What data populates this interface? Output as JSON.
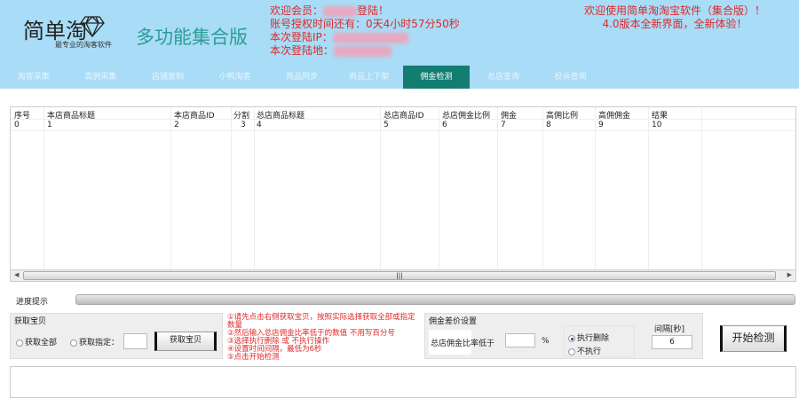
{
  "header": {
    "logo": "简单淘",
    "logo_sub": "最专业的淘客软件",
    "edition": "多功能集合版",
    "welcome_prefix": "欢迎会员：",
    "welcome_suffix": "登陆！",
    "license": "账号授权时间还有：0天4小时57分50秒",
    "ip_label": "本次登陆IP：",
    "location_label": "本次登陆地：",
    "notice_line1": "欢迎使用简单淘淘宝软件（集合版）！",
    "notice_line2": "4.0版本全新界面，全新体验！"
  },
  "nav": {
    "tabs": [
      "淘客采集",
      "高佣采集",
      "店铺复制",
      "小鸭淘客",
      "商品同步",
      "商品上下架",
      "佣金检测",
      "总店查询",
      "投诉查询"
    ],
    "active": "佣金检测",
    "active_color": "#137d72"
  },
  "grid": {
    "columns": [
      "序号",
      "本店商品标题",
      "本店商品ID",
      "分割",
      "总店商品标题",
      "总店商品ID",
      "总店佣金比例",
      "佣金",
      "高佣比例",
      "高佣佣金",
      "结果"
    ],
    "rows": [
      [
        "0",
        "1",
        "2",
        "3",
        "4",
        "5",
        "6",
        "7",
        "8",
        "9",
        "10"
      ]
    ]
  },
  "progress": {
    "label": "进度提示",
    "value": 0
  },
  "fetch": {
    "title": "获取宝贝",
    "opt_all": "获取全部",
    "opt_specified": "获取指定：",
    "count_value": "",
    "button": "获取宝贝"
  },
  "hints": [
    "①请先点击右侧获取宝贝，按照实际选择获取全部或指定数量",
    "②然后输入总店佣金比率低于的数值 不用写百分号",
    "③选择执行删除 或 不执行操作",
    "④设置时间间隔，最低为6秒",
    "⑤点击开始检测"
  ],
  "diff": {
    "title": "佣金差价设置",
    "rate_label": "总店佣金比率低于",
    "rate_value": "",
    "percent": "%",
    "opt_delete": "执行删除",
    "opt_skip": "不执行",
    "interval_label": "间隔[秒]",
    "interval_value": "6"
  },
  "start_button": "开始检测"
}
